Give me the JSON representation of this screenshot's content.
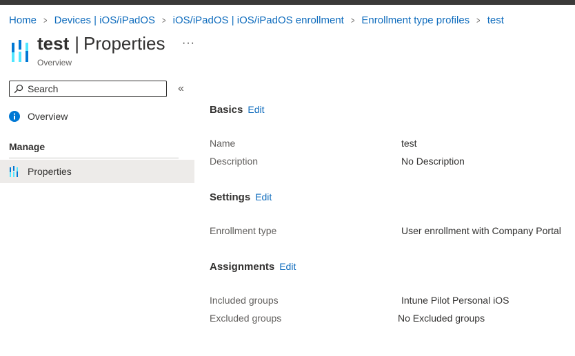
{
  "breadcrumb": [
    {
      "label": "Home"
    },
    {
      "label": "Devices | iOS/iPadOS"
    },
    {
      "label": "iOS/iPadOS | iOS/iPadOS enrollment"
    },
    {
      "label": "Enrollment type profiles"
    },
    {
      "label": "test"
    }
  ],
  "header": {
    "name": "test",
    "separator": "|",
    "page": "Properties",
    "subtitle": "Overview",
    "more": "···"
  },
  "sidebar": {
    "search_placeholder": "Search",
    "collapse_glyph": "«",
    "overview_label": "Overview",
    "section_label": "Manage",
    "properties_label": "Properties"
  },
  "basics": {
    "title": "Basics",
    "edit": "Edit",
    "name_label": "Name",
    "name_value": "test",
    "description_label": "Description",
    "description_value": "No Description"
  },
  "settings": {
    "title": "Settings",
    "edit": "Edit",
    "enrollment_label": "Enrollment type",
    "enrollment_value": "User enrollment with Company Portal"
  },
  "assignments": {
    "title": "Assignments",
    "edit": "Edit",
    "included_label": "Included groups",
    "included_value": "Intune Pilot Personal iOS",
    "excluded_label": "Excluded groups",
    "excluded_value": "No Excluded groups"
  },
  "colors": {
    "link": "#0f6cbd",
    "selected_bg": "#edebe9",
    "icon_blue": "#0078d4",
    "icon_light": "#50e6ff"
  },
  "icons": {
    "page": "properties-icon",
    "search": "search-icon",
    "overview": "info-icon",
    "properties": "properties-icon"
  }
}
